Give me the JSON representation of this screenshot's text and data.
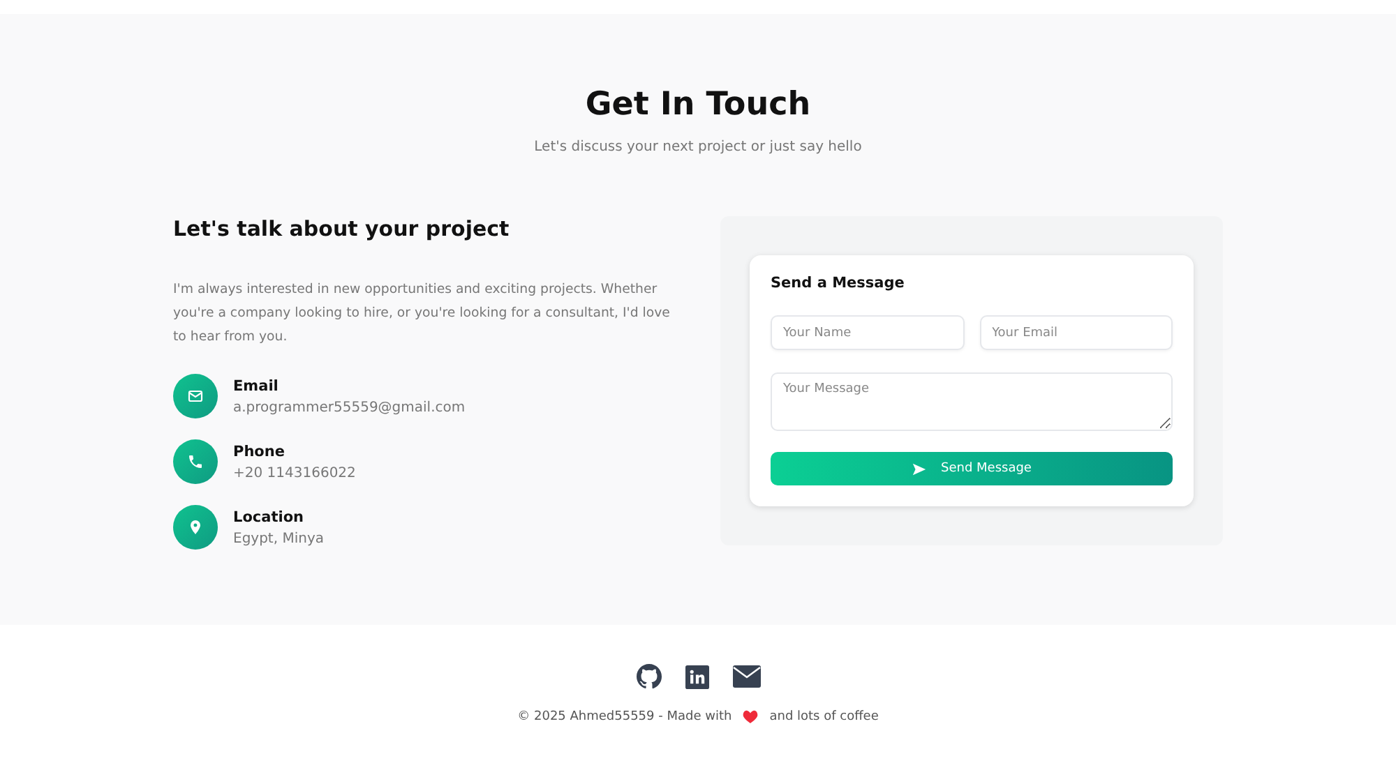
{
  "header": {
    "title": "Get In Touch",
    "subtitle": "Let's discuss your next project or just say hello"
  },
  "intro": {
    "heading": "Let's talk about your project",
    "text": "I'm always interested in new opportunities and exciting projects. Whether you're a company looking to hire, or you're looking for a consultant, I'd love to hear from you."
  },
  "contacts": [
    {
      "kind": "email",
      "label": "Email",
      "value": "a.programmer55559@gmail.com"
    },
    {
      "kind": "phone",
      "label": "Phone",
      "value": "+20 1143166022"
    },
    {
      "kind": "location",
      "label": "Location",
      "value": "Egypt, Minya"
    }
  ],
  "form": {
    "title": "Send a Message",
    "name_placeholder": "Your Name",
    "email_placeholder": "Your Email",
    "message_placeholder": "Your Message",
    "button": "Send Message"
  },
  "footer": {
    "socials": [
      {
        "kind": "github"
      },
      {
        "kind": "linkedin"
      },
      {
        "kind": "mail"
      }
    ],
    "text_before": "© 2025 Ahmed55559 - Made with",
    "text_after": "and lots of coffee"
  }
}
